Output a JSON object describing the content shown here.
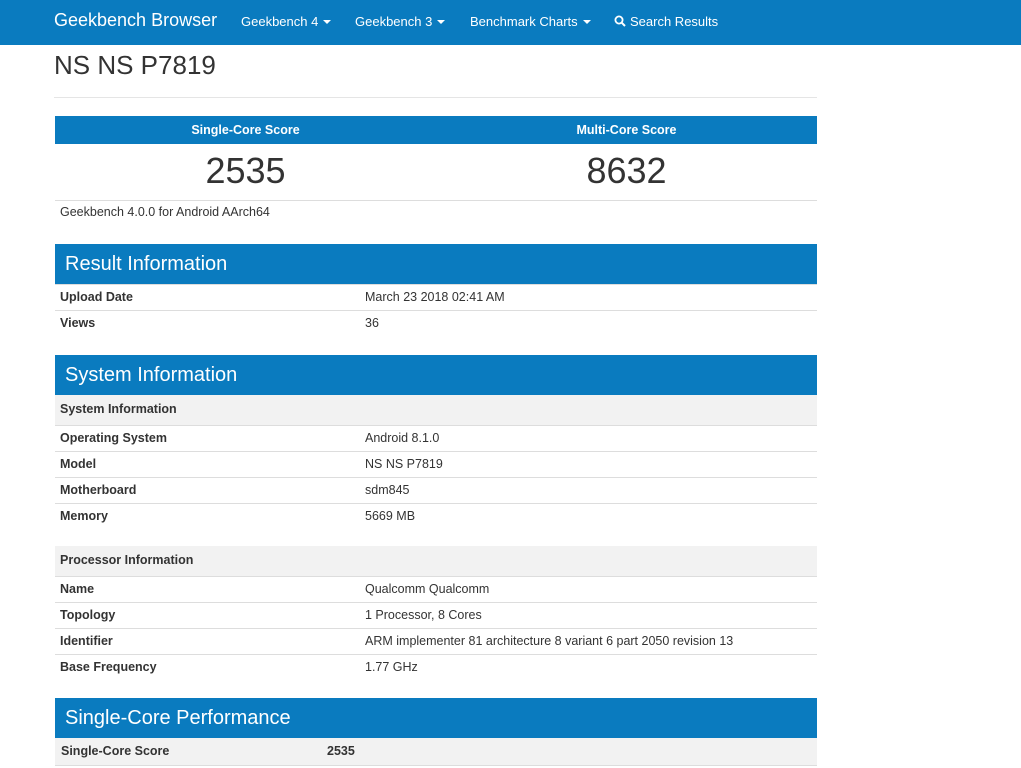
{
  "navbar": {
    "brand": "Geekbench Browser",
    "items": [
      {
        "label": "Geekbench 4"
      },
      {
        "label": "Geekbench 3"
      },
      {
        "label": "Benchmark Charts"
      }
    ],
    "search_label": "Search Results",
    "color": "#0a7bbf"
  },
  "page": {
    "title": "NS NS P7819"
  },
  "scores": {
    "single_label": "Single-Core Score",
    "multi_label": "Multi-Core Score",
    "single_value": "2535",
    "multi_value": "8632",
    "version": "Geekbench 4.0.0 for Android AArch64"
  },
  "result_info": {
    "heading": "Result Information",
    "rows": [
      {
        "key": "Upload Date",
        "value": "March 23 2018 02:41 AM"
      },
      {
        "key": "Views",
        "value": "36"
      }
    ]
  },
  "system_info": {
    "heading": "System Information",
    "system_subheading": "System Information",
    "system_rows": [
      {
        "key": "Operating System",
        "value": "Android 8.1.0"
      },
      {
        "key": "Model",
        "value": "NS NS P7819"
      },
      {
        "key": "Motherboard",
        "value": "sdm845"
      },
      {
        "key": "Memory",
        "value": "5669 MB"
      }
    ],
    "processor_subheading": "Processor Information",
    "processor_rows": [
      {
        "key": "Name",
        "value": "Qualcomm Qualcomm"
      },
      {
        "key": "Topology",
        "value": "1 Processor, 8 Cores"
      },
      {
        "key": "Identifier",
        "value": "ARM implementer 81 architecture 8 variant 6 part 2050 revision 13"
      },
      {
        "key": "Base Frequency",
        "value": "1.77 GHz"
      }
    ]
  },
  "single_core_perf": {
    "heading": "Single-Core Performance",
    "score_label": "Single-Core Score",
    "score_value": "2535"
  }
}
